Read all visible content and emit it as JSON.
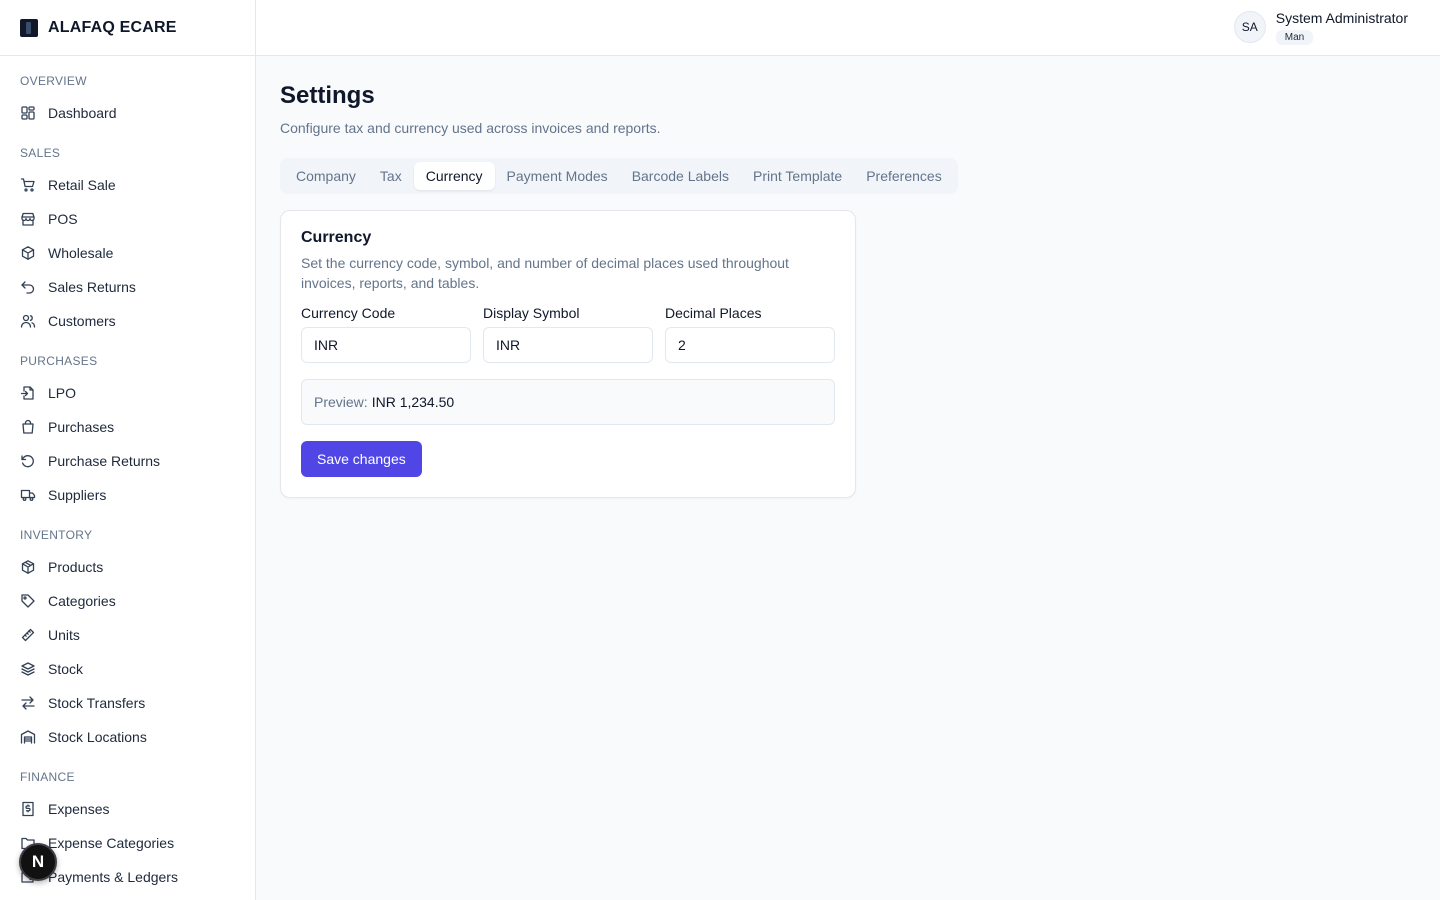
{
  "brand": {
    "name": "ALAFAQ ECARE"
  },
  "sidebar": {
    "sections": [
      {
        "title": "OVERVIEW",
        "items": [
          {
            "label": "Dashboard",
            "icon": "dashboard-icon"
          }
        ]
      },
      {
        "title": "SALES",
        "items": [
          {
            "label": "Retail Sale",
            "icon": "cart-icon"
          },
          {
            "label": "POS",
            "icon": "store-icon"
          },
          {
            "label": "Wholesale",
            "icon": "boxes-icon"
          },
          {
            "label": "Sales Returns",
            "icon": "undo-icon"
          },
          {
            "label": "Customers",
            "icon": "users-icon"
          }
        ]
      },
      {
        "title": "PURCHASES",
        "items": [
          {
            "label": "LPO",
            "icon": "file-import-icon"
          },
          {
            "label": "Purchases",
            "icon": "shopping-bag-icon"
          },
          {
            "label": "Purchase Returns",
            "icon": "rotate-ccw-icon"
          },
          {
            "label": "Suppliers",
            "icon": "truck-icon"
          }
        ]
      },
      {
        "title": "INVENTORY",
        "items": [
          {
            "label": "Products",
            "icon": "package-icon"
          },
          {
            "label": "Categories",
            "icon": "tag-icon"
          },
          {
            "label": "Units",
            "icon": "ruler-icon"
          },
          {
            "label": "Stock",
            "icon": "layers-icon"
          },
          {
            "label": "Stock Transfers",
            "icon": "arrows-exchange-icon"
          },
          {
            "label": "Stock Locations",
            "icon": "warehouse-icon"
          }
        ]
      },
      {
        "title": "FINANCE",
        "items": [
          {
            "label": "Expenses",
            "icon": "receipt-icon"
          },
          {
            "label": "Expense Categories",
            "icon": "folder-icon"
          },
          {
            "label": "Payments & Ledgers",
            "icon": "wallet-icon"
          }
        ]
      }
    ]
  },
  "user": {
    "initials": "SA",
    "name": "System Administrator",
    "role": "Man"
  },
  "page": {
    "title": "Settings",
    "subtitle": "Configure tax and currency used across invoices and reports."
  },
  "tabs": [
    {
      "label": "Company",
      "active": false
    },
    {
      "label": "Tax",
      "active": false
    },
    {
      "label": "Currency",
      "active": true
    },
    {
      "label": "Payment Modes",
      "active": false
    },
    {
      "label": "Barcode Labels",
      "active": false
    },
    {
      "label": "Print Template",
      "active": false
    },
    {
      "label": "Preferences",
      "active": false
    }
  ],
  "card": {
    "title": "Currency",
    "description": "Set the currency code, symbol, and number of decimal places used throughout invoices, reports, and tables.",
    "fields": [
      {
        "label": "Currency Code",
        "value": "INR"
      },
      {
        "label": "Display Symbol",
        "value": "INR"
      },
      {
        "label": "Decimal Places",
        "value": "2"
      }
    ],
    "preview_label": "Preview:",
    "preview_value": "INR 1,234.50",
    "save_label": "Save changes"
  },
  "fab": {
    "letter": "N"
  },
  "colors": {
    "accent": "#4f46e5",
    "sidebar_bg": "#ffffff",
    "page_bg": "#f8fafc"
  }
}
